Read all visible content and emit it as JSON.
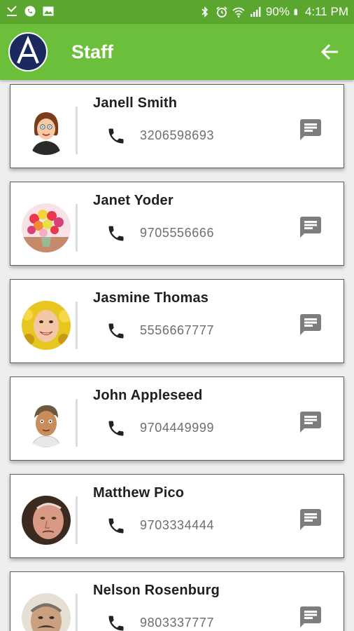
{
  "status_bar": {
    "battery": "90%",
    "time": "4:11 PM",
    "icons_left": [
      "download-icon",
      "whatsapp-icon",
      "image-icon"
    ],
    "icons_right": [
      "bluetooth-icon",
      "alarm-icon",
      "wifi-icon",
      "signal-icon",
      "battery-icon"
    ]
  },
  "app_bar": {
    "title": "Staff",
    "logo_icon": "logo-a-icon",
    "back_icon": "arrow-back-icon",
    "color": "#6bbf3a"
  },
  "staff": [
    {
      "name": "Janell Smith",
      "phone": "3206598693",
      "avatar": "cartoon-woman"
    },
    {
      "name": "Janet Yoder",
      "phone": "9705556666",
      "avatar": "flower-bouquet"
    },
    {
      "name": "Jasmine Thomas",
      "phone": "5556667777",
      "avatar": "smiling-woman"
    },
    {
      "name": "John Appleseed",
      "phone": "9704449999",
      "avatar": "cartoon-man"
    },
    {
      "name": "Matthew Pico",
      "phone": "9703334444",
      "avatar": "older-man"
    },
    {
      "name": "Nelson Rosenburg",
      "phone": "9803337777",
      "avatar": "man-with-mustache"
    }
  ]
}
